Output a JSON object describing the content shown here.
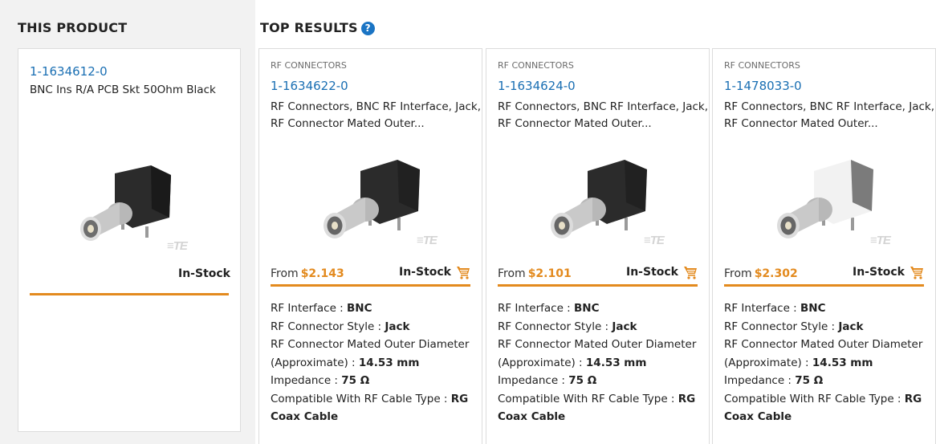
{
  "this_product": {
    "heading": "THIS PRODUCT",
    "part_number": "1-1634612-0",
    "description": "BNC Ins R/A PCB Skt 50Ohm Black",
    "stock": "In-Stock",
    "logo_text": "≡TE"
  },
  "top_results": {
    "heading": "TOP RESULTS",
    "help_icon": "?",
    "items": [
      {
        "category": "RF CONNECTORS",
        "part_number": "1-1634622-0",
        "description": "RF Connectors, BNC RF Interface, Jack, RF Connector Mated Outer...",
        "from_label": "From",
        "price": "$2.143",
        "stock": "In-Stock",
        "logo_text": "≡TE",
        "body_color": "#2b2b2b",
        "attributes": [
          {
            "label": "RF Interface :",
            "value": "BNC"
          },
          {
            "label": "RF Connector Style :",
            "value": "Jack"
          },
          {
            "label": "RF Connector Mated Outer Diameter (Approximate) :",
            "value": "14.53 mm"
          },
          {
            "label": "Impedance :",
            "value": "75 Ω"
          },
          {
            "label": "Compatible With RF Cable Type :",
            "value": "RG Coax Cable"
          }
        ]
      },
      {
        "category": "RF CONNECTORS",
        "part_number": "1-1634624-0",
        "description": "RF Connectors, BNC RF Interface, Jack, RF Connector Mated Outer...",
        "from_label": "From",
        "price": "$2.101",
        "stock": "In-Stock",
        "logo_text": "≡TE",
        "body_color": "#2b2b2b",
        "attributes": [
          {
            "label": "RF Interface :",
            "value": "BNC"
          },
          {
            "label": "RF Connector Style :",
            "value": "Jack"
          },
          {
            "label": "RF Connector Mated Outer Diameter (Approximate) :",
            "value": "14.53 mm"
          },
          {
            "label": "Impedance :",
            "value": "75 Ω"
          },
          {
            "label": "Compatible With RF Cable Type :",
            "value": "RG Coax Cable"
          }
        ]
      },
      {
        "category": "RF CONNECTORS",
        "part_number": "1-1478033-0",
        "description": "RF Connectors, BNC RF Interface, Jack, RF Connector Mated Outer...",
        "from_label": "From",
        "price": "$2.302",
        "stock": "In-Stock",
        "logo_text": "≡TE",
        "body_color": "#f2f2f2",
        "attributes": [
          {
            "label": "RF Interface :",
            "value": "BNC"
          },
          {
            "label": "RF Connector Style :",
            "value": "Jack"
          },
          {
            "label": "RF Connector Mated Outer Diameter (Approximate) :",
            "value": "14.53 mm"
          },
          {
            "label": "Impedance :",
            "value": "75 Ω"
          },
          {
            "label": "Compatible With RF Cable Type :",
            "value": "RG Coax Cable"
          }
        ]
      }
    ]
  },
  "colors": {
    "accent_orange": "#e38a1e",
    "link_blue": "#1a6fb3",
    "help_blue": "#1a74c4",
    "panel_gray": "#f2f2f2"
  }
}
